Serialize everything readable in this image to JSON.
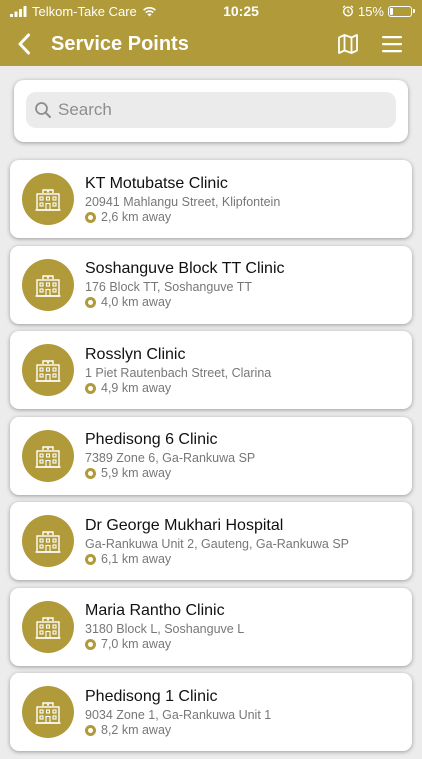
{
  "status": {
    "carrier": "Telkom-Take Care",
    "time": "10:25",
    "battery": "15%",
    "battery_level": 0.15
  },
  "nav": {
    "title": "Service Points",
    "icons": {
      "back": "chevron-left-icon",
      "map": "map-icon",
      "menu": "hamburger-icon"
    }
  },
  "search": {
    "placeholder": "Search",
    "value": ""
  },
  "colors": {
    "accent": "#b09a3a",
    "background": "#ececec"
  },
  "service_points": [
    {
      "name": "KT Motubatse Clinic",
      "address": "20941 Mahlangu Street, Klipfontein",
      "distance": "2,6 km away"
    },
    {
      "name": "Soshanguve Block TT Clinic",
      "address": "176 Block TT, Soshanguve TT",
      "distance": "4,0 km away"
    },
    {
      "name": "Rosslyn Clinic",
      "address": "1 Piet Rautenbach Street, Clarina",
      "distance": "4,9 km away"
    },
    {
      "name": "Phedisong 6 Clinic",
      "address": "7389 Zone 6, Ga-Rankuwa SP",
      "distance": "5,9 km away"
    },
    {
      "name": "Dr George Mukhari Hospital",
      "address": "Ga-Rankuwa Unit 2, Gauteng, Ga-Rankuwa SP",
      "distance": "6,1 km away"
    },
    {
      "name": "Maria Rantho Clinic",
      "address": "3180 Block L, Soshanguve L",
      "distance": "7,0 km away"
    },
    {
      "name": "Phedisong 1 Clinic",
      "address": "9034 Zone 1, Ga-Rankuwa Unit 1",
      "distance": "8,2 km away"
    }
  ]
}
